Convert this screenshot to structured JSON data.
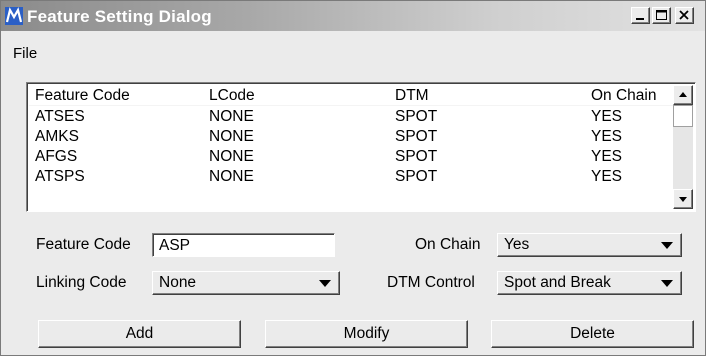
{
  "window": {
    "title": "Feature Setting Dialog",
    "app_icon": "microstation-m-icon",
    "controls": [
      "minimize-icon",
      "maximize-icon",
      "close-icon"
    ]
  },
  "menu": {
    "file_label": "File"
  },
  "feature_list": {
    "columns": [
      "Feature Code",
      "LCode",
      "DTM",
      "On Chain"
    ],
    "rows": [
      [
        "ATSES",
        "NONE",
        "SPOT",
        "YES"
      ],
      [
        "AMKS",
        "NONE",
        "SPOT",
        "YES"
      ],
      [
        "AFGS",
        "NONE",
        "SPOT",
        "YES"
      ],
      [
        "ATSPS",
        "NONE",
        "SPOT",
        "YES"
      ]
    ]
  },
  "form": {
    "feature_code_label": "Feature Code",
    "feature_code_value": "ASP",
    "on_chain_label": "On Chain",
    "on_chain_value": "Yes",
    "linking_code_label": "Linking Code",
    "linking_code_value": "None",
    "dtm_control_label": "DTM Control",
    "dtm_control_value": "Spot and Break"
  },
  "buttons": {
    "add_label": "Add",
    "modify_label": "Modify",
    "delete_label": "Delete"
  },
  "colors": {
    "titlebar_start": "#8b8b8b",
    "titlebar_end": "#e2e2e2",
    "dialog_bg": "#ebebeb",
    "app_icon_blue": "#2b5fc6"
  }
}
